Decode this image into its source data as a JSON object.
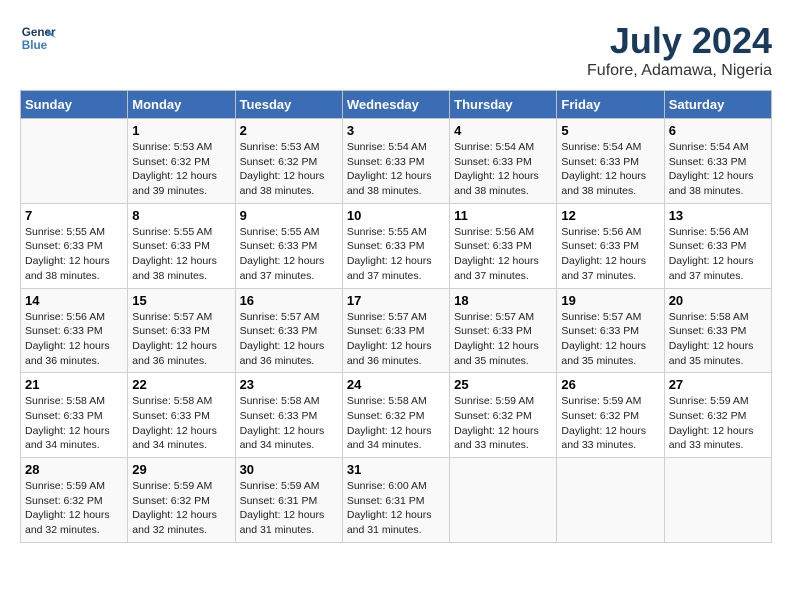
{
  "logo": {
    "text_general": "General",
    "text_blue": "Blue"
  },
  "title": {
    "month_year": "July 2024",
    "location": "Fufore, Adamawa, Nigeria"
  },
  "headers": [
    "Sunday",
    "Monday",
    "Tuesday",
    "Wednesday",
    "Thursday",
    "Friday",
    "Saturday"
  ],
  "weeks": [
    [
      {
        "day": "",
        "sunrise": "",
        "sunset": "",
        "daylight": ""
      },
      {
        "day": "1",
        "sunrise": "Sunrise: 5:53 AM",
        "sunset": "Sunset: 6:32 PM",
        "daylight": "Daylight: 12 hours and 39 minutes."
      },
      {
        "day": "2",
        "sunrise": "Sunrise: 5:53 AM",
        "sunset": "Sunset: 6:32 PM",
        "daylight": "Daylight: 12 hours and 38 minutes."
      },
      {
        "day": "3",
        "sunrise": "Sunrise: 5:54 AM",
        "sunset": "Sunset: 6:33 PM",
        "daylight": "Daylight: 12 hours and 38 minutes."
      },
      {
        "day": "4",
        "sunrise": "Sunrise: 5:54 AM",
        "sunset": "Sunset: 6:33 PM",
        "daylight": "Daylight: 12 hours and 38 minutes."
      },
      {
        "day": "5",
        "sunrise": "Sunrise: 5:54 AM",
        "sunset": "Sunset: 6:33 PM",
        "daylight": "Daylight: 12 hours and 38 minutes."
      },
      {
        "day": "6",
        "sunrise": "Sunrise: 5:54 AM",
        "sunset": "Sunset: 6:33 PM",
        "daylight": "Daylight: 12 hours and 38 minutes."
      }
    ],
    [
      {
        "day": "7",
        "sunrise": "Sunrise: 5:55 AM",
        "sunset": "Sunset: 6:33 PM",
        "daylight": "Daylight: 12 hours and 38 minutes."
      },
      {
        "day": "8",
        "sunrise": "Sunrise: 5:55 AM",
        "sunset": "Sunset: 6:33 PM",
        "daylight": "Daylight: 12 hours and 38 minutes."
      },
      {
        "day": "9",
        "sunrise": "Sunrise: 5:55 AM",
        "sunset": "Sunset: 6:33 PM",
        "daylight": "Daylight: 12 hours and 37 minutes."
      },
      {
        "day": "10",
        "sunrise": "Sunrise: 5:55 AM",
        "sunset": "Sunset: 6:33 PM",
        "daylight": "Daylight: 12 hours and 37 minutes."
      },
      {
        "day": "11",
        "sunrise": "Sunrise: 5:56 AM",
        "sunset": "Sunset: 6:33 PM",
        "daylight": "Daylight: 12 hours and 37 minutes."
      },
      {
        "day": "12",
        "sunrise": "Sunrise: 5:56 AM",
        "sunset": "Sunset: 6:33 PM",
        "daylight": "Daylight: 12 hours and 37 minutes."
      },
      {
        "day": "13",
        "sunrise": "Sunrise: 5:56 AM",
        "sunset": "Sunset: 6:33 PM",
        "daylight": "Daylight: 12 hours and 37 minutes."
      }
    ],
    [
      {
        "day": "14",
        "sunrise": "Sunrise: 5:56 AM",
        "sunset": "Sunset: 6:33 PM",
        "daylight": "Daylight: 12 hours and 36 minutes."
      },
      {
        "day": "15",
        "sunrise": "Sunrise: 5:57 AM",
        "sunset": "Sunset: 6:33 PM",
        "daylight": "Daylight: 12 hours and 36 minutes."
      },
      {
        "day": "16",
        "sunrise": "Sunrise: 5:57 AM",
        "sunset": "Sunset: 6:33 PM",
        "daylight": "Daylight: 12 hours and 36 minutes."
      },
      {
        "day": "17",
        "sunrise": "Sunrise: 5:57 AM",
        "sunset": "Sunset: 6:33 PM",
        "daylight": "Daylight: 12 hours and 36 minutes."
      },
      {
        "day": "18",
        "sunrise": "Sunrise: 5:57 AM",
        "sunset": "Sunset: 6:33 PM",
        "daylight": "Daylight: 12 hours and 35 minutes."
      },
      {
        "day": "19",
        "sunrise": "Sunrise: 5:57 AM",
        "sunset": "Sunset: 6:33 PM",
        "daylight": "Daylight: 12 hours and 35 minutes."
      },
      {
        "day": "20",
        "sunrise": "Sunrise: 5:58 AM",
        "sunset": "Sunset: 6:33 PM",
        "daylight": "Daylight: 12 hours and 35 minutes."
      }
    ],
    [
      {
        "day": "21",
        "sunrise": "Sunrise: 5:58 AM",
        "sunset": "Sunset: 6:33 PM",
        "daylight": "Daylight: 12 hours and 34 minutes."
      },
      {
        "day": "22",
        "sunrise": "Sunrise: 5:58 AM",
        "sunset": "Sunset: 6:33 PM",
        "daylight": "Daylight: 12 hours and 34 minutes."
      },
      {
        "day": "23",
        "sunrise": "Sunrise: 5:58 AM",
        "sunset": "Sunset: 6:33 PM",
        "daylight": "Daylight: 12 hours and 34 minutes."
      },
      {
        "day": "24",
        "sunrise": "Sunrise: 5:58 AM",
        "sunset": "Sunset: 6:32 PM",
        "daylight": "Daylight: 12 hours and 34 minutes."
      },
      {
        "day": "25",
        "sunrise": "Sunrise: 5:59 AM",
        "sunset": "Sunset: 6:32 PM",
        "daylight": "Daylight: 12 hours and 33 minutes."
      },
      {
        "day": "26",
        "sunrise": "Sunrise: 5:59 AM",
        "sunset": "Sunset: 6:32 PM",
        "daylight": "Daylight: 12 hours and 33 minutes."
      },
      {
        "day": "27",
        "sunrise": "Sunrise: 5:59 AM",
        "sunset": "Sunset: 6:32 PM",
        "daylight": "Daylight: 12 hours and 33 minutes."
      }
    ],
    [
      {
        "day": "28",
        "sunrise": "Sunrise: 5:59 AM",
        "sunset": "Sunset: 6:32 PM",
        "daylight": "Daylight: 12 hours and 32 minutes."
      },
      {
        "day": "29",
        "sunrise": "Sunrise: 5:59 AM",
        "sunset": "Sunset: 6:32 PM",
        "daylight": "Daylight: 12 hours and 32 minutes."
      },
      {
        "day": "30",
        "sunrise": "Sunrise: 5:59 AM",
        "sunset": "Sunset: 6:31 PM",
        "daylight": "Daylight: 12 hours and 31 minutes."
      },
      {
        "day": "31",
        "sunrise": "Sunrise: 6:00 AM",
        "sunset": "Sunset: 6:31 PM",
        "daylight": "Daylight: 12 hours and 31 minutes."
      },
      {
        "day": "",
        "sunrise": "",
        "sunset": "",
        "daylight": ""
      },
      {
        "day": "",
        "sunrise": "",
        "sunset": "",
        "daylight": ""
      },
      {
        "day": "",
        "sunrise": "",
        "sunset": "",
        "daylight": ""
      }
    ]
  ]
}
